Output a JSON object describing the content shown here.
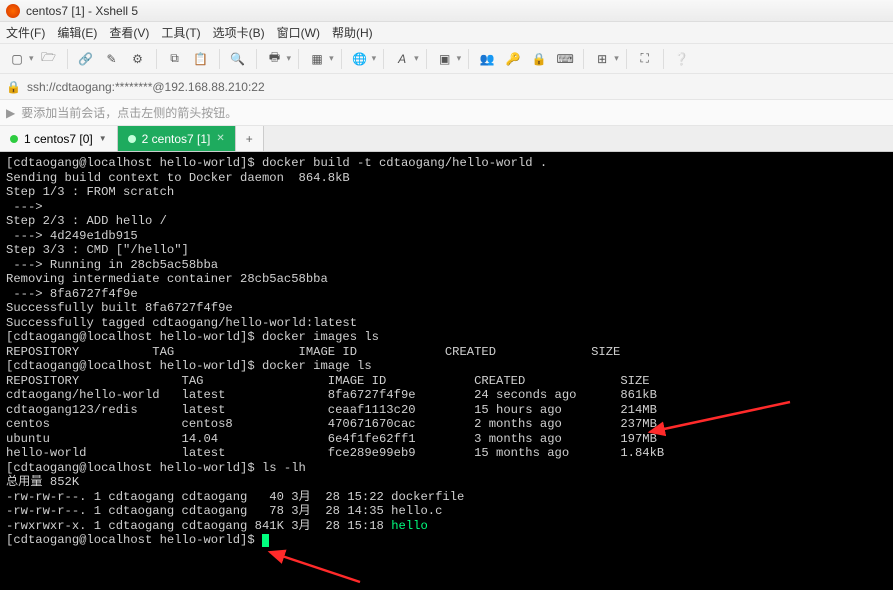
{
  "window": {
    "title": "centos7 [1] - Xshell 5"
  },
  "menu": {
    "file": "文件(F)",
    "edit": "编辑(E)",
    "view": "查看(V)",
    "tools": "工具(T)",
    "tabs": "选项卡(B)",
    "window": "窗口(W)",
    "help": "帮助(H)"
  },
  "address": {
    "proto_icon": "⎘",
    "url": "ssh://cdtaogang:********@192.168.88.210:22"
  },
  "hint": {
    "icon": "▸",
    "text": "要添加当前会话，点击左侧的箭头按钮。"
  },
  "tabs": {
    "t1": {
      "label": "1 centos7 [0]"
    },
    "t2": {
      "label": "2 centos7 [1]"
    },
    "add": "+"
  },
  "term": {
    "l01": "[cdtaogang@localhost hello-world]$ docker build -t cdtaogang/hello-world .",
    "l02": "Sending build context to Docker daemon  864.8kB",
    "l03": "Step 1/3 : FROM scratch",
    "l04": " ---> ",
    "l05": "Step 2/3 : ADD hello /",
    "l06": " ---> 4d249e1db915",
    "l07": "Step 3/3 : CMD [\"/hello\"]",
    "l08": " ---> Running in 28cb5ac58bba",
    "l09": "Removing intermediate container 28cb5ac58bba",
    "l10": " ---> 8fa6727f4f9e",
    "l11": "Successfully built 8fa6727f4f9e",
    "l12": "Successfully tagged cdtaogang/hello-world:latest",
    "l13": "[cdtaogang@localhost hello-world]$ docker images ls",
    "l14": "REPOSITORY          TAG                 IMAGE ID            CREATED             SIZE",
    "l15": "[cdtaogang@localhost hello-world]$ docker image ls",
    "l16": "REPOSITORY              TAG                 IMAGE ID            CREATED             SIZE",
    "l17": "cdtaogang/hello-world   latest              8fa6727f4f9e        24 seconds ago      861kB",
    "l18": "cdtaogang123/redis      latest              ceaaf1113c20        15 hours ago        214MB",
    "l19": "centos                  centos8             470671670cac        2 months ago        237MB",
    "l20": "ubuntu                  14.04               6e4f1fe62ff1        3 months ago        197MB",
    "l21": "hello-world             latest              fce289e99eb9        15 months ago       1.84kB",
    "l22": "[cdtaogang@localhost hello-world]$ ls -lh",
    "l23": "总用量 852K",
    "l24": "-rw-rw-r--. 1 cdtaogang cdtaogang   40 3月  28 15:22 dockerfile",
    "l25": "-rw-rw-r--. 1 cdtaogang cdtaogang   78 3月  28 14:35 hello.c",
    "l26a": "-rwxrwxr-x. 1 cdtaogang cdtaogang 841K 3月  28 15:18 ",
    "l26b": "hello",
    "l27": "[cdtaogang@localhost hello-world]$ "
  }
}
